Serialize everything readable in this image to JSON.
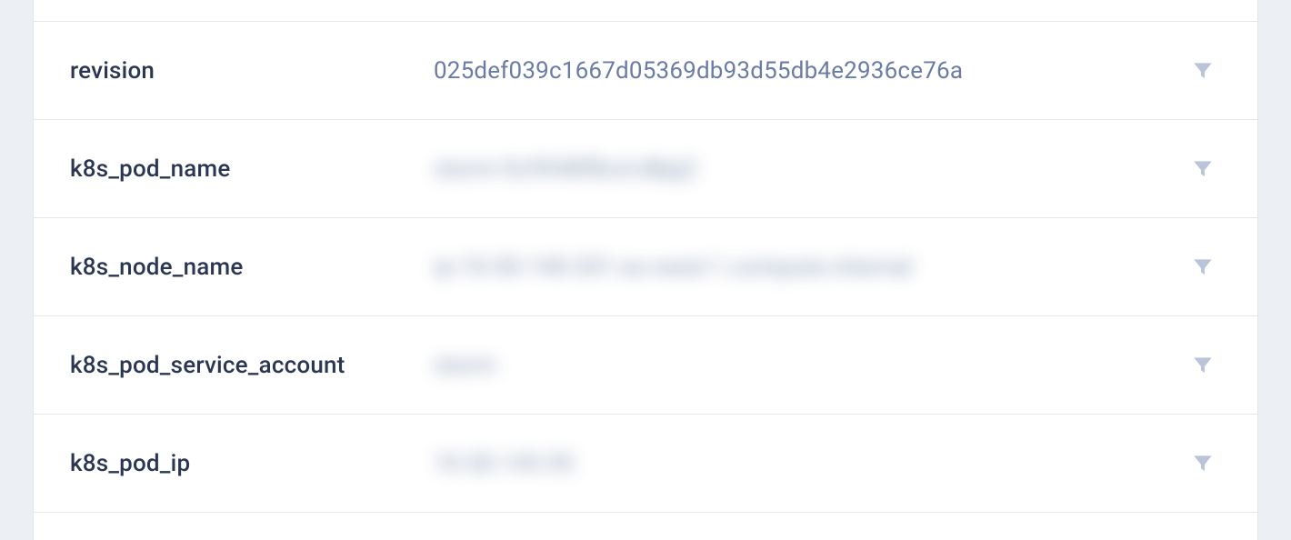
{
  "rows": [
    {
      "key": "revision",
      "value": "025def039c1667d05369db93d55db4e2936ce76a",
      "blurred": false
    },
    {
      "key": "k8s_pod_name",
      "value": "storm-5c9948f8cd-d8pj2",
      "blurred": true
    },
    {
      "key": "k8s_node_name",
      "value": "ip-10-30-140-201.eu-west-1.compute.internal",
      "blurred": true
    },
    {
      "key": "k8s_pod_service_account",
      "value": "storm",
      "blurred": true
    },
    {
      "key": "k8s_pod_ip",
      "value": "10.30.143.55",
      "blurred": true
    }
  ],
  "icons": {
    "filter": "filter-icon"
  }
}
